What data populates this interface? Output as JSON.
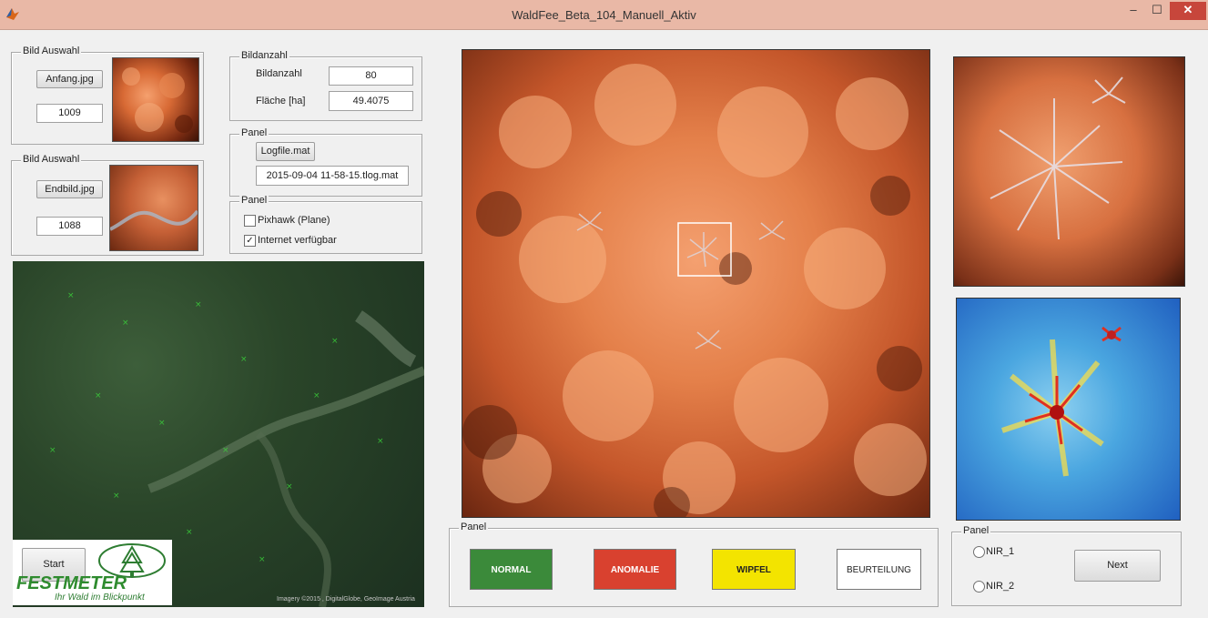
{
  "window": {
    "title": "WaldFee_Beta_104_Manuell_Aktiv",
    "minimize": "–",
    "maximize": "☐",
    "close": "✕"
  },
  "bild_auswahl_1": {
    "legend": "Bild Auswahl",
    "button": "Anfang.jpg",
    "value": "1009"
  },
  "bild_auswahl_2": {
    "legend": "Bild Auswahl",
    "button": "Endbild.jpg",
    "value": "1088"
  },
  "bildanzahl_panel": {
    "legend": "Bildanzahl",
    "bildanzahl_label": "Bildanzahl",
    "bildanzahl_value": "80",
    "flaeche_label": "Fläche [ha]",
    "flaeche_value": "49.4075"
  },
  "logfile_panel": {
    "legend": "Panel",
    "button": "Logfile.mat",
    "value": "2015-09-04 11-58-15.tlog.mat"
  },
  "options_panel": {
    "legend": "Panel",
    "pixhawk_label": "Pixhawk (Plane)",
    "pixhawk_checked": false,
    "internet_label": "Internet verfügbar",
    "internet_checked": true
  },
  "map": {
    "start_button": "Start",
    "logo_title": "FESTMETER",
    "logo_subtitle": "Ihr Wald im Blickpunkt",
    "attribution": "Imagery ©2015 , DigitalGlobe, GeoImage Austria"
  },
  "classification_panel": {
    "legend": "Panel",
    "normal": "NORMAL",
    "anomalie": "ANOMALIE",
    "wipfel": "WIPFEL",
    "beurteilung": "BEURTEILUNG"
  },
  "nir_panel": {
    "legend": "Panel",
    "nir1": "NIR_1",
    "nir2": "NIR_2",
    "next": "Next"
  },
  "colors": {
    "normal": "#3b8a3a",
    "anomalie": "#d9412f",
    "wipfel": "#f3e400",
    "titlebar": "#e9b8a6",
    "close": "#c7463b"
  }
}
